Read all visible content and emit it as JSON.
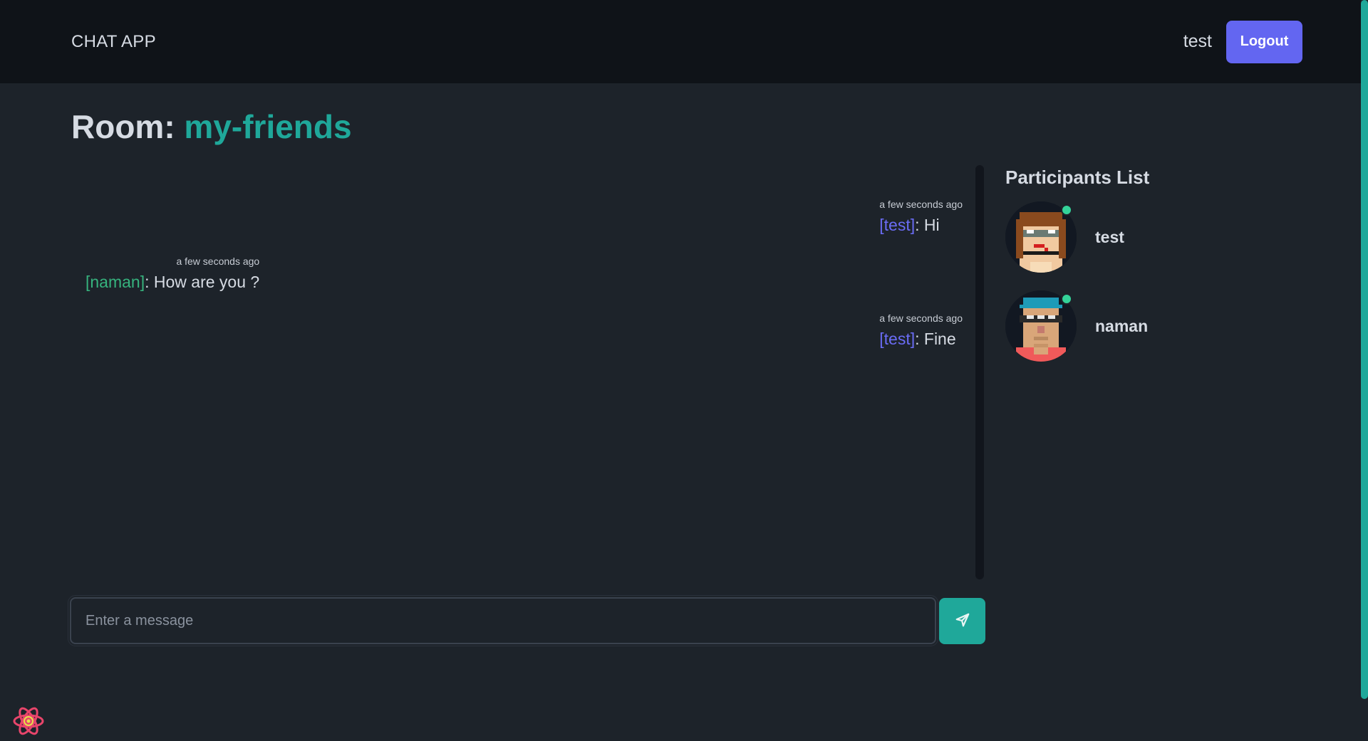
{
  "navbar": {
    "brand": "CHAT APP",
    "username": "test",
    "logout_label": "Logout"
  },
  "room": {
    "prefix": "Room:",
    "name": "my-friends"
  },
  "messages": [
    {
      "time": "a few seconds ago",
      "author": "[test]",
      "text": ": Hi",
      "side": "right"
    },
    {
      "time": "a few seconds ago",
      "author": "[naman]",
      "text": ": How are you ?",
      "side": "left"
    },
    {
      "time": "a few seconds ago",
      "author": "[test]",
      "text": ": Fine",
      "side": "right"
    }
  ],
  "participants": {
    "title": "Participants List",
    "items": [
      {
        "name": "test",
        "status": "online"
      },
      {
        "name": "naman",
        "status": "online"
      }
    ]
  },
  "composer": {
    "placeholder": "Enter a message",
    "send_icon": "send-icon"
  },
  "colors": {
    "accent": "#1fa89a",
    "button": "#6366f1",
    "online": "#34d399",
    "author_self": "#6a6cf5",
    "author_other": "#36b37e"
  }
}
